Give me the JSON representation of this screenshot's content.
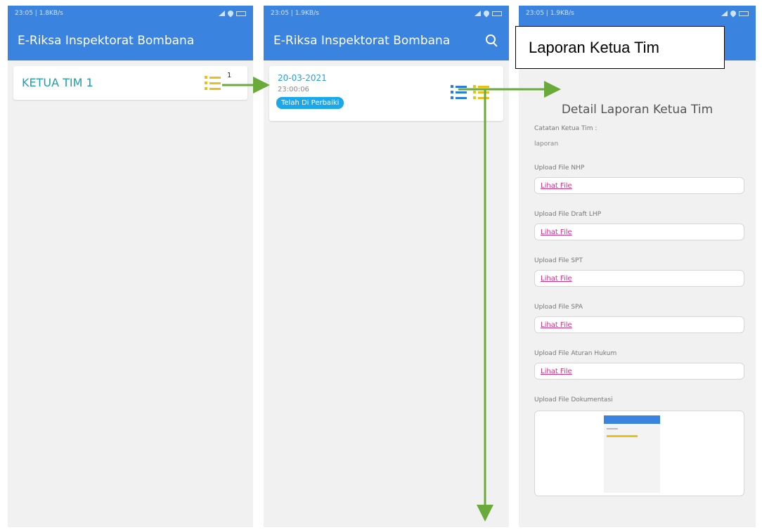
{
  "colors": {
    "appbar": "#3a84e0",
    "team_name": "#1aa0b0",
    "link": "#d0308a",
    "arrow": "#6aaa3a",
    "icon_yellow": "#e8c21a",
    "icon_blue": "#2b7be0"
  },
  "screen1": {
    "status_time": "23:05 | 1.8KB/s",
    "title": "E-Riksa Inspektorat Bombana",
    "team_card": {
      "name": "KETUA TIM 1",
      "count": "1",
      "icon": "list-icon"
    }
  },
  "screen2": {
    "status_time": "23:05 | 1.9KB/s",
    "title": "E-Riksa Inspektorat Bombana",
    "search_icon": "search-icon",
    "report": {
      "date": "20-03-2021",
      "time": "23:00:06",
      "status": "Telah Di Perbaiki"
    }
  },
  "screen3": {
    "status_time": "23:05 | 1.9KB/s",
    "callout": "Laporan Ketua Tim",
    "detail_title": "Detail Laporan Ketua Tim",
    "notes_label": "Catatan Ketua Tim :",
    "notes_value": "laporan",
    "files": [
      {
        "label": "Upload File NHP",
        "link": "Lihat File"
      },
      {
        "label": "Upload File Draft LHP",
        "link": "Lihat File"
      },
      {
        "label": "Upload File SPT",
        "link": "Lihat File"
      },
      {
        "label": "Upload File SPA",
        "link": "Lihat File"
      },
      {
        "label": "Upload File Aturan Hukum",
        "link": "Lihat File"
      }
    ],
    "doc_label": "Upload File Dokumentasi"
  }
}
